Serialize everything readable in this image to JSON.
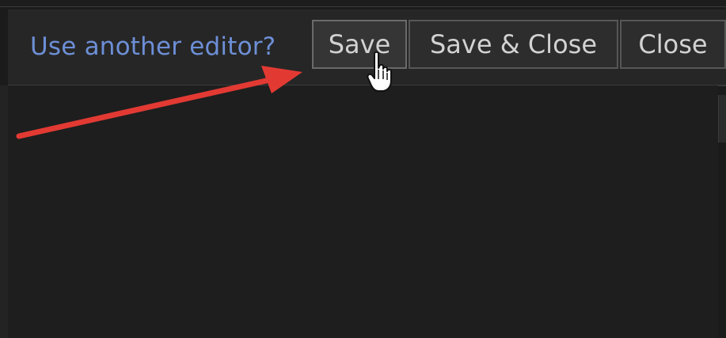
{
  "toolbar": {
    "editor_link": "Use another editor?",
    "save_label": "Save",
    "save_close_label": "Save & Close",
    "close_label": "Close"
  },
  "colors": {
    "background": "#1b1b1b",
    "toolbar": "#262626",
    "link": "#6d8fd6",
    "button_text": "#d2d2d2",
    "annotation_arrow": "#e23a33"
  },
  "icons": {
    "cursor": "hand-pointer-icon",
    "annotation": "red-arrow-icon"
  }
}
